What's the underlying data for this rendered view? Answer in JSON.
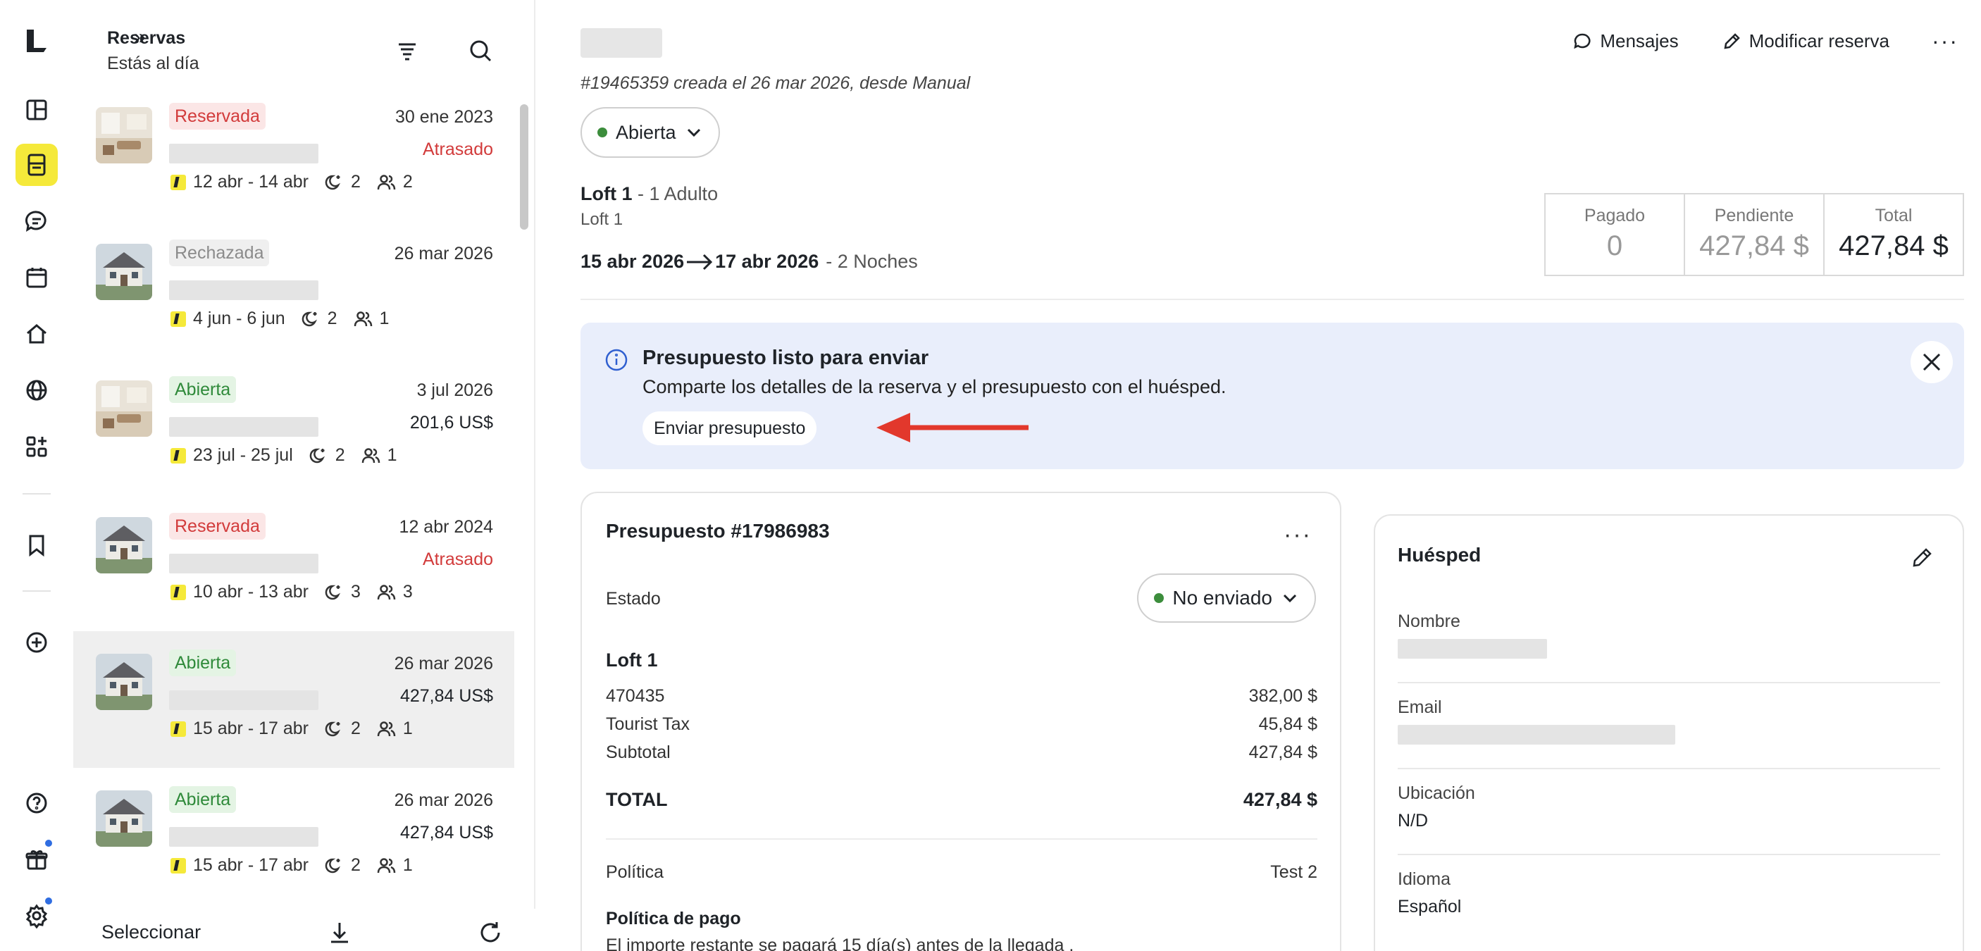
{
  "list": {
    "title": "Reservas",
    "subtitle": "Estás al día",
    "select_label": "Seleccionar",
    "items": [
      {
        "status": "Reservada",
        "status_kind": "red",
        "date": "30 ene 2023",
        "extra": "Atrasado",
        "extra_kind": "late",
        "thumb": "interior",
        "range": "12 abr - 14 abr",
        "nights": "2",
        "guests": "2"
      },
      {
        "status": "Rechazada",
        "status_kind": "gray",
        "date": "26 mar 2026",
        "extra": "",
        "extra_kind": "",
        "thumb": "house",
        "range": "4 jun - 6 jun",
        "nights": "2",
        "guests": "1"
      },
      {
        "status": "Abierta",
        "status_kind": "green",
        "date": "3 jul 2026",
        "extra": "201,6 US$",
        "extra_kind": "price",
        "thumb": "interior",
        "range": "23 jul - 25 jul",
        "nights": "2",
        "guests": "1"
      },
      {
        "status": "Reservada",
        "status_kind": "red",
        "date": "12 abr 2024",
        "extra": "Atrasado",
        "extra_kind": "late",
        "thumb": "house",
        "range": "10 abr - 13 abr",
        "nights": "3",
        "guests": "3"
      },
      {
        "status": "Abierta",
        "status_kind": "green",
        "date": "26 mar 2026",
        "extra": "427,84 US$",
        "extra_kind": "price",
        "thumb": "house",
        "range": "15 abr - 17 abr",
        "nights": "2",
        "guests": "1",
        "selected": true
      },
      {
        "status": "Abierta",
        "status_kind": "green",
        "date": "26 mar 2026",
        "extra": "427,84 US$",
        "extra_kind": "price",
        "thumb": "house",
        "range": "15 abr - 17 abr",
        "nights": "2",
        "guests": "1"
      }
    ]
  },
  "header": {
    "messages_label": "Mensajes",
    "edit_label": "Modificar reserva",
    "more_label": "···",
    "created_text": "#19465359 creada el 26 mar 2026, desde Manual",
    "state_label": "Abierta"
  },
  "booking": {
    "unit_name": "Loft 1",
    "unit_occupancy": " - 1 Adulto",
    "unit_sub": "Loft 1",
    "checkin": "15 abr 2026",
    "checkout": "17 abr 2026",
    "nights_text": "- 2 Noches"
  },
  "totals": {
    "paid_label": "Pagado",
    "paid_value": "0",
    "pending_label": "Pendiente",
    "pending_value": "427,84 $",
    "total_label": "Total",
    "total_value": "427,84 $"
  },
  "banner": {
    "title": "Presupuesto listo para enviar",
    "description": "Comparte los detalles de la reserva y el presupuesto con el huésped.",
    "button_label": "Enviar presupuesto",
    "accent": "#e2382c"
  },
  "quote": {
    "title": "Presupuesto #17986983",
    "more_label": "···",
    "state_label": "Estado",
    "state_value": "No enviado",
    "unit_name": "Loft 1",
    "lines": [
      {
        "label": "470435",
        "amount": "382,00 $"
      },
      {
        "label": "Tourist Tax",
        "amount": "45,84 $"
      },
      {
        "label": "Subtotal",
        "amount": "427,84 $"
      }
    ],
    "total_label": "TOTAL",
    "total_value": "427,84 $",
    "policy_label": "Política",
    "policy_value": "Test 2",
    "payment_policy_title": "Política de pago",
    "payment_policy_text": "El importe restante se pagará 15 día(s) antes de la llegada ."
  },
  "guest": {
    "title": "Huésped",
    "name_label": "Nombre",
    "email_label": "Email",
    "location_label": "Ubicación",
    "location_value": "N/D",
    "language_label": "Idioma",
    "language_value": "Español"
  },
  "colors": {
    "brand_yellow": "#f5e93a",
    "status_red": "#d23b3b",
    "status_green": "#2f8a3a",
    "info_bg": "#e9eefb",
    "notify_dot": "#2f6de1"
  }
}
